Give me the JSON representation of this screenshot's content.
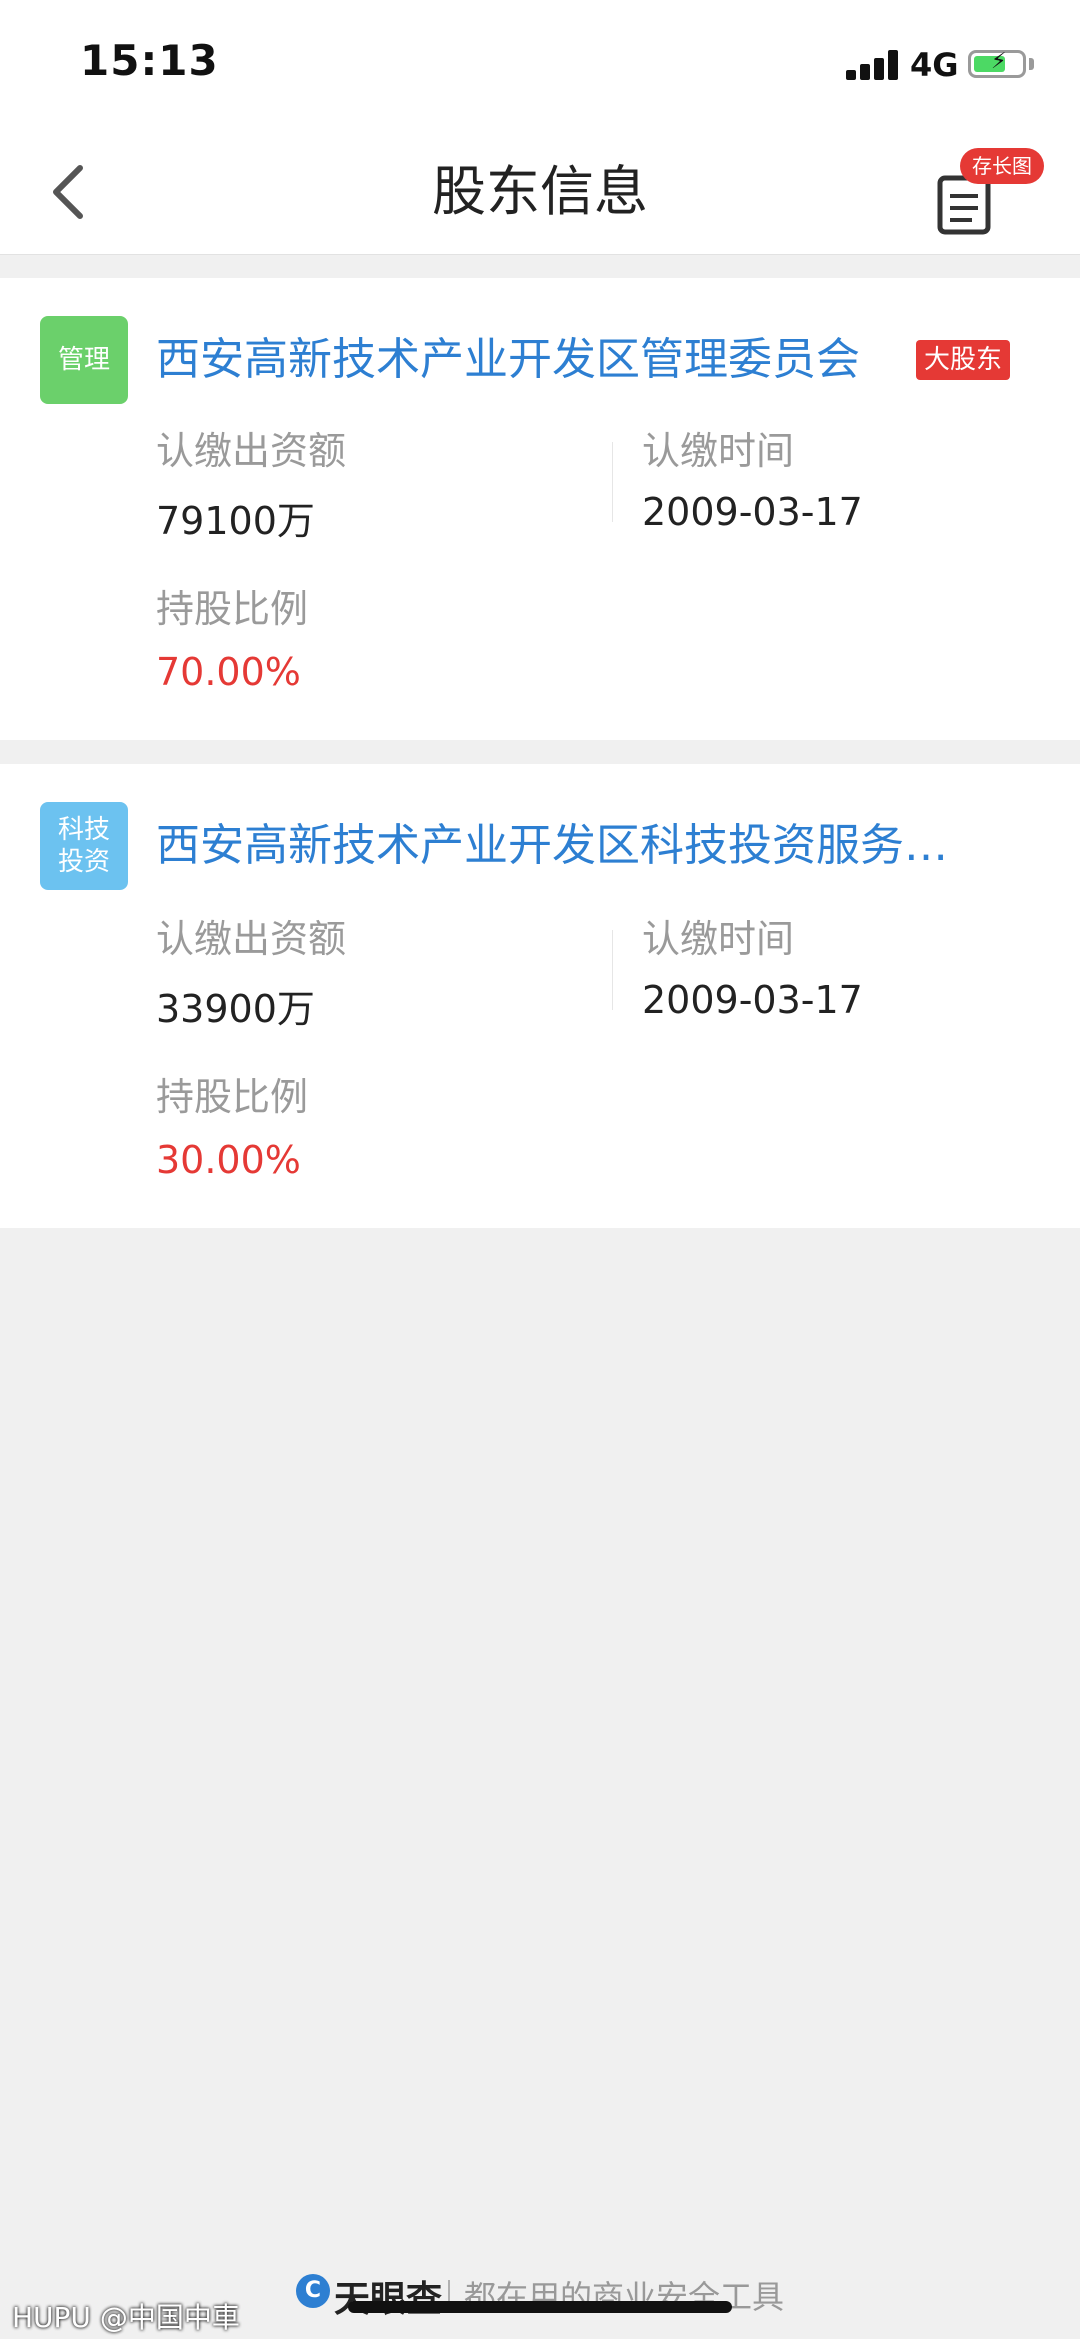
{
  "status_bar": {
    "time": "15:13",
    "network": "4G",
    "icons": [
      "signal-icon",
      "battery-charging-icon"
    ]
  },
  "navbar": {
    "title": "股东信息",
    "back_icon": "chevron-left-icon",
    "save_icon": "document-icon",
    "save_badge": "存长图"
  },
  "shareholders": [
    {
      "tag": "管理",
      "tag_color": "#6bd06b",
      "name": "西安高新技术产业开发区管理委员会",
      "badge": "大股东",
      "subscribed_amount_label": "认缴出资额",
      "subscribed_amount": "79100万",
      "subscribed_time_label": "认缴时间",
      "subscribed_time": "2009-03-17",
      "ratio_label": "持股比例",
      "ratio": "70.00%"
    },
    {
      "tag_line1": "科技",
      "tag_line2": "投资",
      "tag_color": "#6cc2f0",
      "name": "西安高新技术产业开发区科技投资服务…",
      "subscribed_amount_label": "认缴出资额",
      "subscribed_amount": "33900万",
      "subscribed_time_label": "认缴时间",
      "subscribed_time": "2009-03-17",
      "ratio_label": "持股比例",
      "ratio": "30.00%"
    }
  ],
  "footer": {
    "brand": "天眼查",
    "slogan": "都在用的商业安全工具"
  },
  "watermark": "HUPU @中国中車",
  "colors": {
    "link_blue": "#2d7fd2",
    "ratio_red": "#e53935",
    "label_gray": "#9a9a9a",
    "page_bg": "#f0f0f0"
  }
}
